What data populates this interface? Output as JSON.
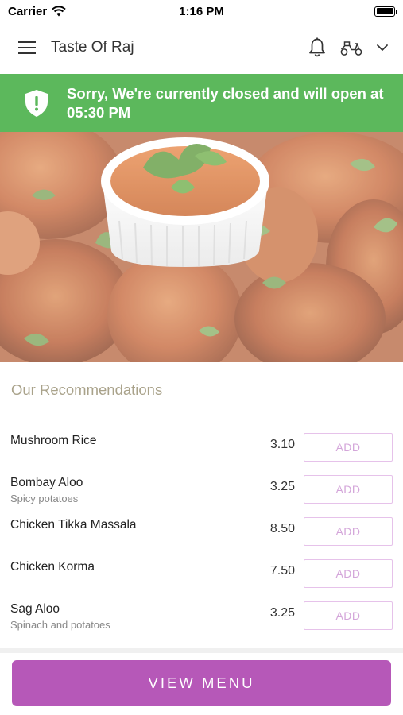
{
  "status_bar": {
    "carrier": "Carrier",
    "time": "1:16 PM",
    "battery_level": 1.0
  },
  "header": {
    "title": "Taste Of Raj"
  },
  "banner": {
    "message": "Sorry, We're currently closed and will open at 05:30 PM",
    "color": "#5cb85c"
  },
  "recommendations": {
    "title": "Our Recommendations",
    "add_label": "ADD",
    "items": [
      {
        "name": "Mushroom Rice",
        "description": "",
        "price": "3.10"
      },
      {
        "name": "Bombay Aloo",
        "description": "Spicy potatoes",
        "price": "3.25"
      },
      {
        "name": "Chicken Tikka Massala",
        "description": "",
        "price": "8.50"
      },
      {
        "name": "Chicken Korma",
        "description": "",
        "price": "7.50"
      },
      {
        "name": "Sag Aloo",
        "description": "Spinach and potatoes",
        "price": "3.25"
      }
    ]
  },
  "footer": {
    "view_menu_label": "VIEW MENU",
    "accent": "#b658b8"
  },
  "icons": [
    "wifi-icon",
    "battery-icon",
    "hamburger-menu-icon",
    "bell-icon",
    "scooter-icon",
    "chevron-down-icon",
    "shield-alert-icon"
  ]
}
